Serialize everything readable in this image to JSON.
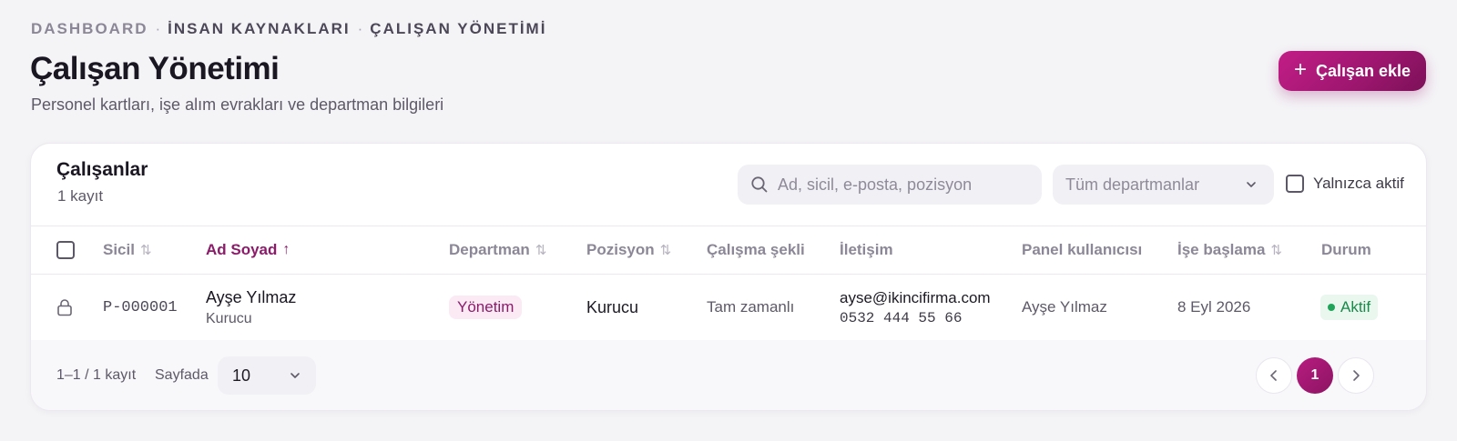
{
  "breadcrumb": {
    "items": [
      "DASHBOARD",
      "İNSAN KAYNAKLARI",
      "ÇALIŞAN YÖNETİMİ"
    ],
    "separator": "·"
  },
  "page": {
    "title": "Çalışan Yönetimi",
    "subtitle": "Personel kartları, işe alım evrakları ve departman bilgileri",
    "add_button_label": "Çalışan ekle",
    "add_button_icon": "plus-icon"
  },
  "card": {
    "title": "Çalışanlar",
    "count_text": "1 kayıt"
  },
  "filters": {
    "search_placeholder": "Ad, sicil, e-posta, pozisyon",
    "search_value": "",
    "department_value": "Tüm departmanlar",
    "active_only_label": "Yalnızca aktif",
    "active_only_checked": false
  },
  "table": {
    "columns": {
      "sicil": "Sicil",
      "ad_soyad": "Ad Soyad",
      "departman": "Departman",
      "pozisyon": "Pozisyon",
      "calisma_sekli": "Çalışma şekli",
      "iletisim": "İletişim",
      "panel_kullanicisi": "Panel kullanıcısı",
      "ise_baslama": "İşe başlama",
      "durum": "Durum"
    },
    "sorted_column": "ad_soyad",
    "sort_direction": "asc",
    "rows": [
      {
        "lock_icon": "lock-icon",
        "sicil": "P-000001",
        "ad_soyad": "Ayşe Yılmaz",
        "ad_soyad_sub": "Kurucu",
        "departman": "Yönetim",
        "pozisyon": "Kurucu",
        "calisma_sekli": "Tam zamanlı",
        "email": "ayse@ikincifirma.com",
        "telefon": "0532 444 55 66",
        "panel_kullanicisi": "Ayşe Yılmaz",
        "ise_baslama": "8 Eyl 2026",
        "durum": "Aktif"
      }
    ]
  },
  "pagination": {
    "range_text": "1–1 / 1 kayıt",
    "per_page_label": "Sayfada",
    "per_page_value": "10",
    "current_page": "1"
  },
  "colors": {
    "accent": "#9c166e",
    "status_active": "#1a8a4a",
    "background": "#f4f3f6"
  }
}
